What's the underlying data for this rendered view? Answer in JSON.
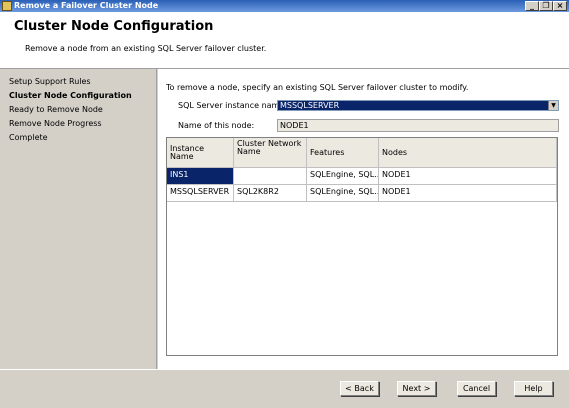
{
  "window": {
    "title": "Remove a Failover Cluster Node"
  },
  "header": {
    "title": "Cluster Node Configuration",
    "subtitle": "Remove a node from an existing SQL Server failover cluster."
  },
  "nav": {
    "items": [
      {
        "label": "Setup Support Rules",
        "active": false
      },
      {
        "label": "Cluster Node Configuration",
        "active": true
      },
      {
        "label": "Ready to Remove Node",
        "active": false
      },
      {
        "label": "Remove Node Progress",
        "active": false
      },
      {
        "label": "Complete",
        "active": false
      }
    ]
  },
  "main": {
    "instruction": "To remove a node, specify an existing SQL Server failover cluster to modify.",
    "instance_label": "SQL Server instance name:",
    "instance_value": "MSSQLSERVER",
    "node_label": "Name of this node:",
    "node_value": "NODE1",
    "table": {
      "headers": [
        "Instance Name",
        "Cluster Network Name",
        "Features",
        "Nodes"
      ],
      "rows": [
        [
          "INS1",
          "",
          "SQLEngine, SQL...",
          "NODE1"
        ],
        [
          "MSSQLSERVER",
          "SQL2K8R2",
          "SQLEngine, SQL...",
          "NODE1"
        ]
      ]
    }
  },
  "footer": {
    "back": "< Back",
    "next": "Next >",
    "cancel": "Cancel",
    "help": "Help"
  },
  "colors": {
    "titlebar": "#2a5fb6",
    "selection": "#0a246a",
    "chrome": "#d4d0c8"
  },
  "icons": [
    "app-icon",
    "minimize-icon",
    "restore-icon",
    "close-icon",
    "dropdown-arrow-icon"
  ]
}
